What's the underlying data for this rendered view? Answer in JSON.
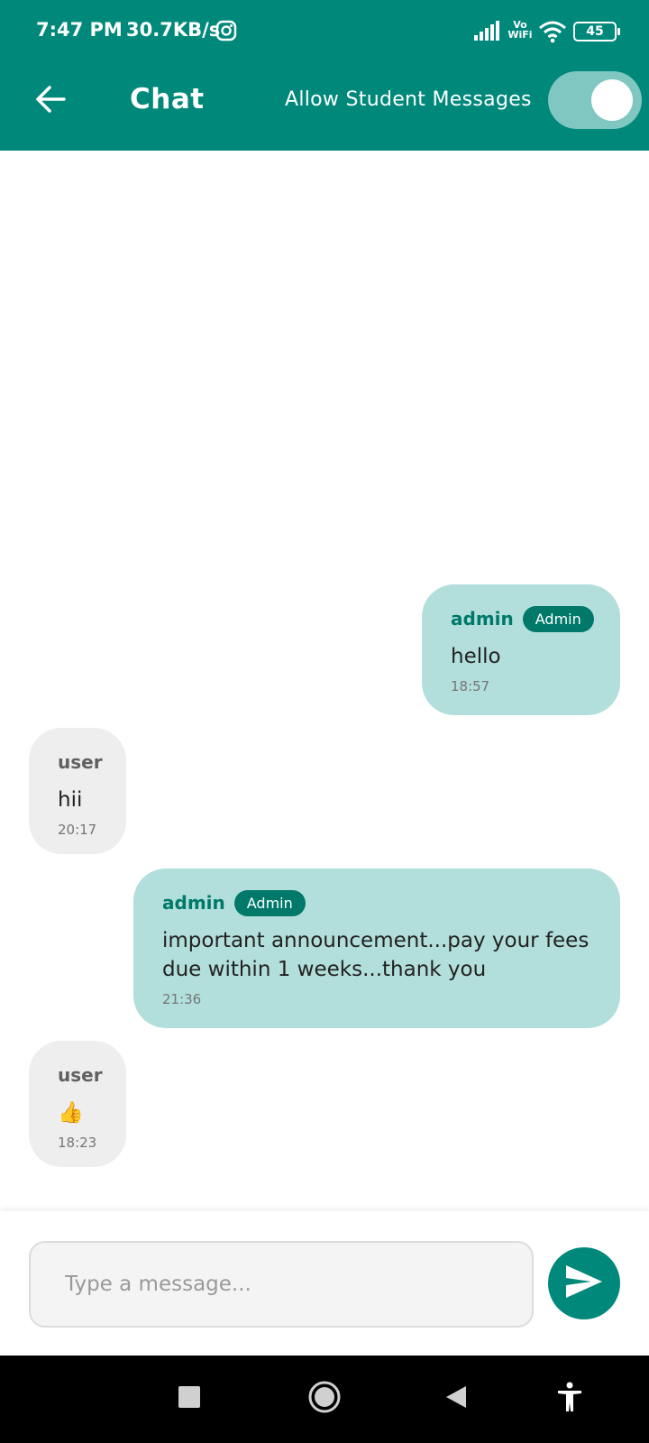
{
  "status_bar": {
    "time": "7:47 PM",
    "network_speed": "30.7KB/s",
    "vowifi": "Vo\nWiFi",
    "battery": "45"
  },
  "app_bar": {
    "title": "Chat",
    "toggle_label": "Allow Student Messages",
    "toggle_on": true
  },
  "messages": [
    {
      "sender": "admin",
      "badge": "Admin",
      "text": "hello",
      "time": "18:57",
      "side": "right"
    },
    {
      "sender": "user",
      "text": "hii",
      "time": "20:17",
      "side": "left"
    },
    {
      "sender": "admin",
      "badge": "Admin",
      "text": "important announcement...pay your fees due within 1 weeks...thank you",
      "time": "21:36",
      "side": "right"
    },
    {
      "sender": "user",
      "text": "👍",
      "time": "18:23",
      "side": "left"
    }
  ],
  "composer": {
    "placeholder": "Type a message..."
  },
  "colors": {
    "primary": "#00897b",
    "admin_bubble": "#b2dfdb",
    "user_bubble": "#eeeeee",
    "badge": "#00796b"
  },
  "icons": {
    "back": "arrow-left-icon",
    "send": "send-icon",
    "nav": [
      "square-icon",
      "circle-icon",
      "triangle-back-icon",
      "accessibility-icon"
    ]
  }
}
